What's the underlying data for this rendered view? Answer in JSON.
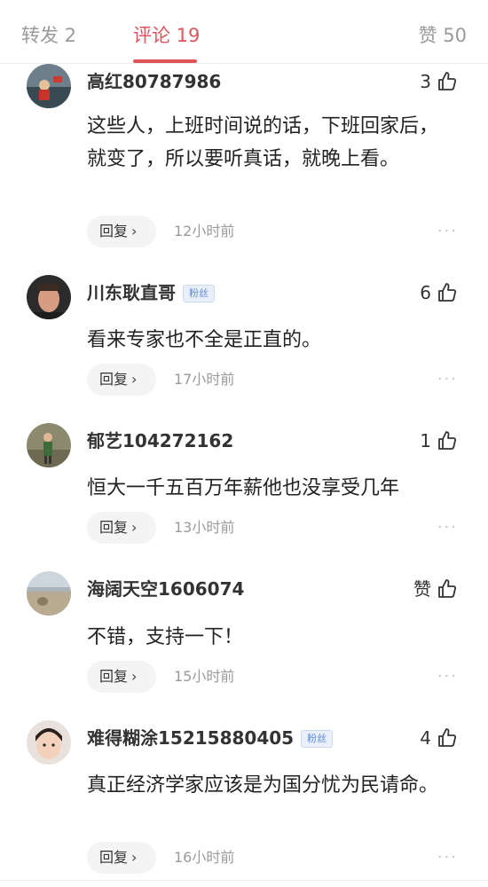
{
  "tabs": {
    "reposts": "转发 2",
    "comments": "评论 19",
    "likes": "赞 50"
  },
  "comments": [
    {
      "name": "高红80787986",
      "badge": "",
      "likes": "3",
      "text": "这些人，上班时间说的话，下班回家后，就变了，所以要听真话，就晚上看。",
      "reply": "回复",
      "time": "12小时前"
    },
    {
      "name": "川东耿直哥",
      "badge": "粉丝",
      "likes": "6",
      "text": "看来专家也不全是正直的。",
      "reply": "回复",
      "time": "17小时前"
    },
    {
      "name": "郁艺104272162",
      "badge": "",
      "likes": "1",
      "text": "恒大一千五百万年薪他也没享受几年",
      "reply": "回复",
      "time": "13小时前"
    },
    {
      "name": "海阔天空1606074",
      "badge": "",
      "likes": "赞",
      "text": "不错，支持一下！",
      "reply": "回复",
      "time": "15小时前"
    },
    {
      "name": "难得糊涂15215880405",
      "badge": "粉丝",
      "likes": "4",
      "text": "真正经济学家应该是为国分忧为民请命。",
      "reply": "回复",
      "time": "16小时前"
    }
  ],
  "more_label": "···",
  "colors": {
    "accent": "#e0535b",
    "muted": "#9a9a9a",
    "badge": "#5b8bd6"
  }
}
